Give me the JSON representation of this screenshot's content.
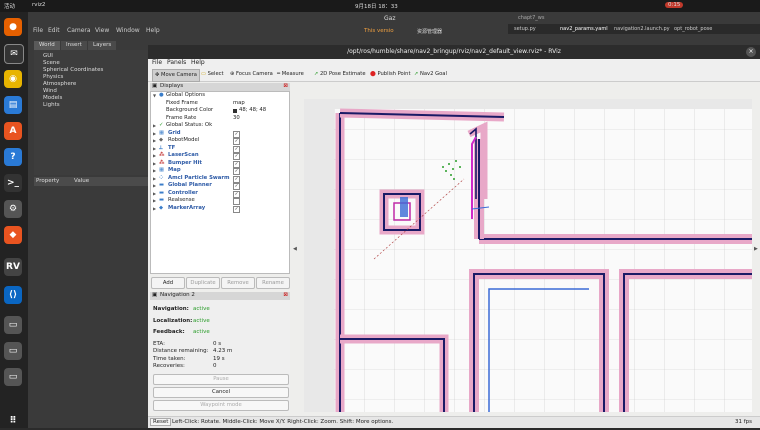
{
  "topbar": {
    "activities": "活动",
    "app": "rviz2",
    "clock": "9月18日 18：33",
    "battery": "0:15",
    "gazebo_title": "Gaz",
    "version": "This versio",
    "tray_label": "资源管理器",
    "tab_files": [
      "setup.py",
      "nav2_params.yaml",
      "navigation2.launch.py",
      "opt_robot_pose"
    ],
    "tab_sub": "chapt7_ws"
  },
  "gazebo": {
    "menu": [
      "File",
      "Edit",
      "Camera",
      "View",
      "Window",
      "Help"
    ],
    "tabs": [
      "World",
      "Insert",
      "Layers"
    ],
    "tree": [
      "GUI",
      "Scene",
      "Spherical Coordinates",
      "Physics",
      "Atmosphere",
      "Wind",
      "Models",
      "Lights"
    ],
    "prop_headers": [
      "Property",
      "Value"
    ]
  },
  "rviz": {
    "title": "/opt/ros/humble/share/nav2_bringup/rviz/nav2_default_view.rviz* - RViz",
    "menu": [
      "File",
      "Panels",
      "Help"
    ],
    "tools": [
      "Move Camera",
      "Select",
      "Focus Camera",
      "Measure",
      "2D Pose Estimate",
      "Publish Point",
      "Nav2 Goal"
    ],
    "displays_title": "Displays",
    "global_options": "Global Options",
    "fixed_frame_label": "Fixed Frame",
    "fixed_frame": "map",
    "bg_color_label": "Background Color",
    "bg_color": "48; 48; 48",
    "frame_rate_label": "Frame Rate",
    "frame_rate": "30",
    "global_status": "Global Status: Ok",
    "displays": [
      "Grid",
      "RobotModel",
      "TF",
      "LaserScan",
      "Bumper Hit",
      "Map",
      "Amcl Particle Swarm",
      "Global Planner",
      "Controller",
      "Realsense",
      "MarkerArray"
    ],
    "buttons": [
      "Add",
      "Duplicate",
      "Remove",
      "Rename"
    ],
    "nav2_title": "Navigation 2",
    "nav_label": "Navigation:",
    "nav_value": "active",
    "loc_label": "Localization:",
    "loc_value": "active",
    "fb_label": "Feedback:",
    "fb_value": "active",
    "eta_label": "ETA:",
    "eta_value": "0 s",
    "dist_label": "Distance remaining:",
    "dist_value": "4.23 m",
    "time_label": "Time taken:",
    "time_value": "19 s",
    "rec_label": "Recoveries:",
    "rec_value": "0",
    "pause": "Pause",
    "cancel": "Cancel",
    "waypoint": "Waypoint mode",
    "reset": "Reset",
    "status": "Left-Click: Rotate. Middle-Click: Move X/Y. Right-Click: Zoom. Shift: More options.",
    "fps": "31 fps"
  },
  "colors": {
    "accent": "#3d8ad6",
    "path": "#d02ac8",
    "costmap": "#e8a8c8"
  }
}
